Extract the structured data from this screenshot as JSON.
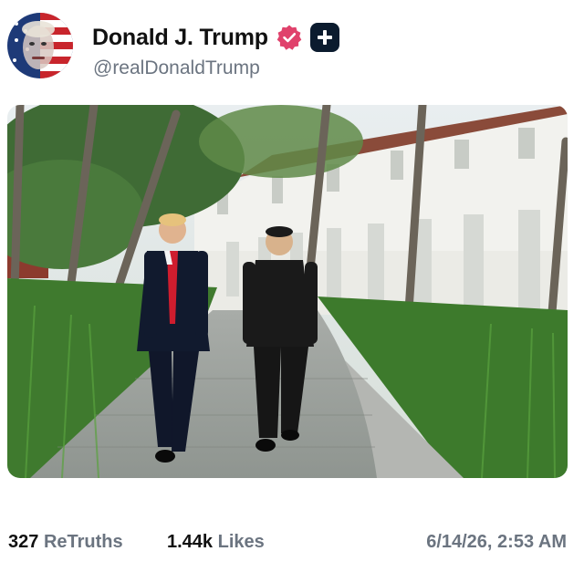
{
  "post": {
    "author": {
      "display_name": "Donald J. Trump",
      "handle": "@realDonaldTrump",
      "verified_icon": "verified-badge-icon",
      "plus_icon": "plus-badge-icon",
      "verified_color": "#e0426c"
    },
    "media": {
      "icon": "photo"
    },
    "stats": {
      "retruths_count": "327",
      "retruths_label": "ReTruths",
      "likes_count": "1.44k",
      "likes_label": "Likes",
      "timestamp": "6/14/26, 2:53 AM"
    }
  }
}
